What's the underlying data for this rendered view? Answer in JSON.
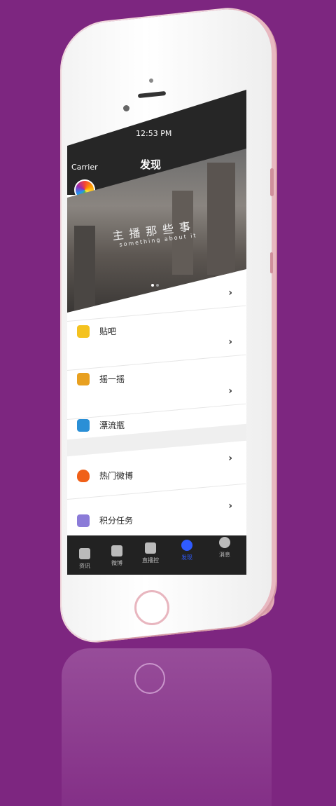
{
  "status": {
    "carrier": "Carrier",
    "time": "12:53 PM"
  },
  "nav": {
    "title": "发现"
  },
  "banner": {
    "title": "主播那些事",
    "subtitle": "something about it"
  },
  "list": [
    {
      "label": "",
      "icon": "banner-row-icon"
    },
    {
      "label": "贴吧",
      "icon": "tieba-icon"
    },
    {
      "label": "摇一摇",
      "icon": "shake-icon"
    },
    {
      "label": "漂流瓶",
      "icon": "bottle-icon"
    },
    {
      "label": "热门微博",
      "icon": "hot-weibo-icon"
    },
    {
      "label": "积分任务",
      "icon": "points-task-icon"
    }
  ],
  "tabs": [
    {
      "label": "资讯",
      "icon": "news-icon"
    },
    {
      "label": "微博",
      "icon": "weibo-home-icon"
    },
    {
      "label": "直播控",
      "icon": "live-play-icon"
    },
    {
      "label": "发现",
      "icon": "discover-planet-icon"
    },
    {
      "label": "消息",
      "icon": "message-bubble-icon"
    }
  ],
  "colors": {
    "background": "#7d2680",
    "accent": "#2f5bff",
    "tabbar": "#222222",
    "phone_body": "#f5f5f5",
    "phone_trim": "#e8b6bf"
  }
}
